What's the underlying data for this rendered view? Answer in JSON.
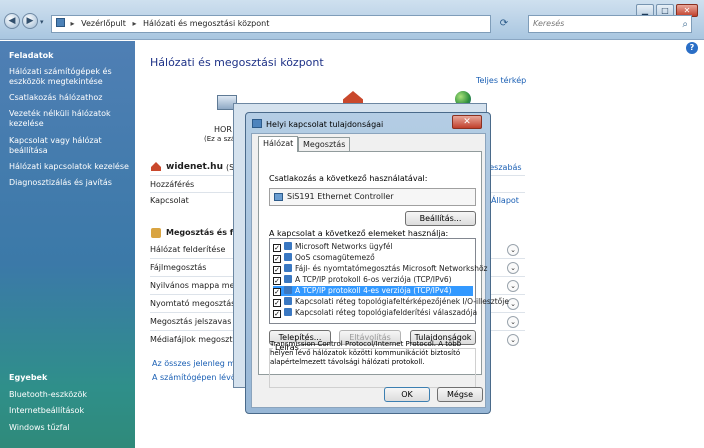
{
  "window": {
    "breadcrumbs": [
      "Vezérlőpult",
      "Hálózati és megosztási központ"
    ],
    "search_placeholder": "Keresés"
  },
  "left_panel": {
    "tasks_title": "Feladatok",
    "tasks": [
      "Hálózati számítógépek és eszközök megtekintése",
      "Csatlakozás hálózathoz",
      "Vezeték nélküli hálózatok kezelése",
      "Kapcsolat vagy hálózat beállítása",
      "Hálózati kapcsolatok kezelése",
      "Diagnosztizálás és javítás"
    ],
    "see_also_title": "Egyebek",
    "see_also": [
      "Bluetooth-eszközök",
      "Internetbeállítások",
      "Windows tűzfal"
    ]
  },
  "main": {
    "title": "Hálózati és megosztási központ",
    "full_map": "Teljes térkép",
    "map_label_top": "HOR",
    "map_label_sub": "(Ez a szám",
    "network_name": "widenet.hu",
    "network_suffix": "(Szem",
    "customize_link": "rreszabás",
    "access_label": "Hozzáférés",
    "connection_label": "Kapcsolat",
    "status_link": "Állapot",
    "sharing_title": "Megosztás és felde",
    "sharing_rows": [
      "Hálózat felderítése",
      "Fájlmegosztás",
      "Nyilvános mappa megos",
      "Nyomtató megosztása",
      "Megosztás jelszavas véd",
      "Médiafájlok megosztása"
    ],
    "bottom_links": [
      "Az összes jelenleg megosz",
      "A számítógépen lévő össze"
    ]
  },
  "dialog": {
    "title": "Helyi kapcsolat tulajdonságai",
    "tabs": [
      "Hálózat",
      "Megosztás"
    ],
    "connect_using_label": "Csatlakozás a következő használatával:",
    "adapter": "SiS191 Ethernet Controller",
    "configure_button": "Beállítás...",
    "items_label": "A kapcsolat a következő elemeket használja:",
    "items": [
      {
        "label": "Microsoft Networks ügyfél",
        "checked": true
      },
      {
        "label": "QoS csomagütemező",
        "checked": true
      },
      {
        "label": "Fájl- és nyomtatómegosztás Microsoft Networkshöz",
        "checked": true
      },
      {
        "label": "A TCP/IP protokoll 6-os verziója (TCP/IPv6)",
        "checked": true
      },
      {
        "label": "A TCP/IP protokoll 4-es verziója (TCP/IPv4)",
        "checked": true,
        "selected": true
      },
      {
        "label": "Kapcsolati réteg topológiafeltérképezőjének I/O-illesztője",
        "checked": true
      },
      {
        "label": "Kapcsolati réteg topológiafelderítési válaszadója",
        "checked": true
      }
    ],
    "install_button": "Telepítés...",
    "uninstall_button": "Eltávolítás",
    "properties_button": "Tulajdonságok",
    "description_label": "Leírás",
    "description_text": "Transmission Control Protocol/Internet Protocol. A több helyen lévő hálózatok közötti kommunikációt biztosító alapértelmezett távolsági hálózati protokoll.",
    "ok_button": "OK",
    "cancel_button": "Mégse"
  }
}
